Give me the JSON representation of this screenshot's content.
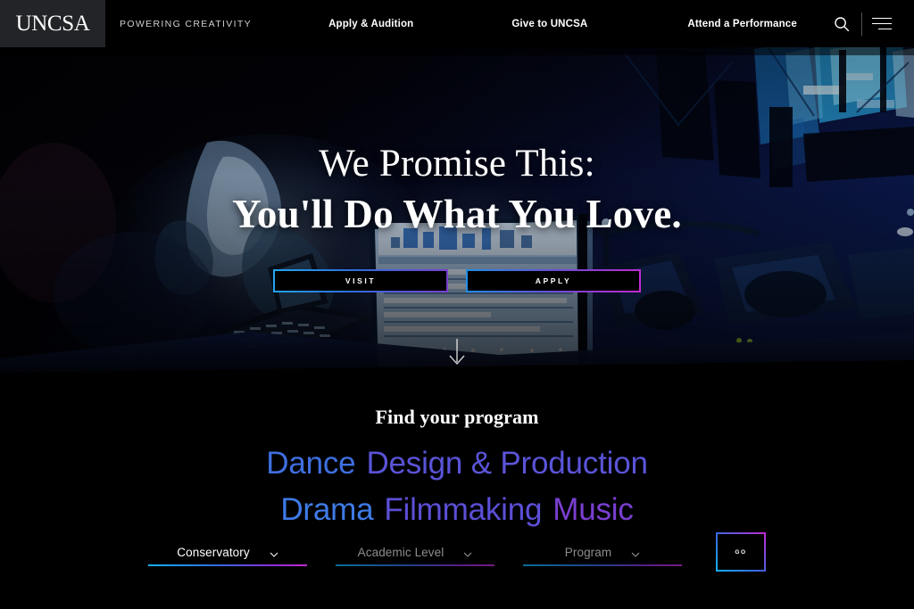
{
  "nav": {
    "logo": "UNCSA",
    "tagline": "POWERING CREATIVITY",
    "links": [
      {
        "label": "Apply & Audition"
      },
      {
        "label": "Give to UNCSA"
      },
      {
        "label": "Attend a Performance"
      }
    ],
    "search_icon": "search-icon",
    "menu_icon": "hamburger-menu-icon"
  },
  "hero": {
    "headline_line1": "We Promise This:",
    "headline_line2": "You'll Do What You Love.",
    "buttons": [
      {
        "label": "VISIT"
      },
      {
        "label": "APPLY"
      }
    ],
    "scroll_indicator": "arrow-down-icon"
  },
  "programs": {
    "title": "Find your program",
    "items": [
      {
        "label": "Dance",
        "color": "#3f6fe0"
      },
      {
        "label": "Design & Production",
        "color": "#5a54d8"
      },
      {
        "label": "Drama",
        "color": "#3f7ae6"
      },
      {
        "label": "Filmmaking",
        "color": "#5b4fd6"
      },
      {
        "label": "Music",
        "color": "#7a3fd0"
      }
    ]
  },
  "filters": {
    "conservatory": {
      "value": "Conservatory",
      "state": "selected"
    },
    "academic_level": {
      "value": "Academic Level",
      "state": "placeholder"
    },
    "program": {
      "value": "Program",
      "state": "placeholder"
    },
    "go_label": "GO"
  },
  "theme": {
    "background": "#000000",
    "logo_block": "#232428",
    "accent_cyan": "#12b0f0",
    "accent_blue": "#2f6fe0",
    "accent_purple": "#7b3fd0",
    "accent_magenta": "#c22ad0",
    "text_primary": "#ffffff",
    "text_muted": "#8d8d8d"
  }
}
